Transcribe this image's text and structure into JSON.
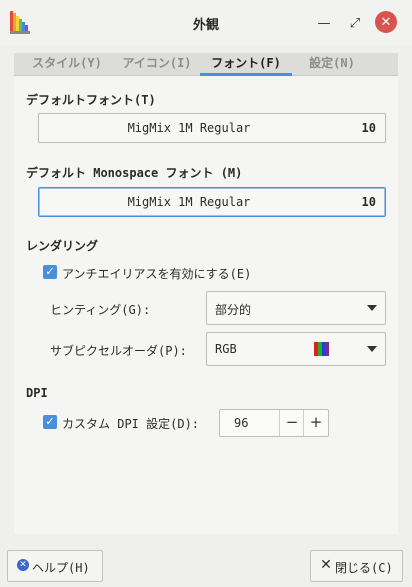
{
  "window": {
    "title": "外観"
  },
  "tabs": [
    "スタイル(Y)",
    "アイコン(I)",
    "フォント(F)",
    "設定(N)"
  ],
  "fonts": {
    "default_heading": "デフォルトフォント(T)",
    "default_font": "MigMix 1M Regular",
    "default_size": "10",
    "mono_heading": "デフォルト Monospace フォント (M)",
    "mono_font": "MigMix 1M Regular",
    "mono_size": "10"
  },
  "rendering": {
    "heading": "レンダリング",
    "antialias_label": "アンチエイリアスを有効にする(E)",
    "antialias_checked": true,
    "hinting_label": "ヒンティング(G):",
    "hinting_value": "部分的",
    "subpixel_label": "サブピクセルオーダ(P):",
    "subpixel_value": "RGB"
  },
  "dpi": {
    "heading": "DPI",
    "custom_label": "カスタム DPI 設定(D):",
    "custom_checked": true,
    "value": "96",
    "minus": "−",
    "plus": "+"
  },
  "footer": {
    "help_label": "ヘルプ(H)",
    "close_label": "閉じる(C)"
  },
  "colors": {
    "accent": "#4a90d9",
    "close_button": "#d9534f"
  }
}
